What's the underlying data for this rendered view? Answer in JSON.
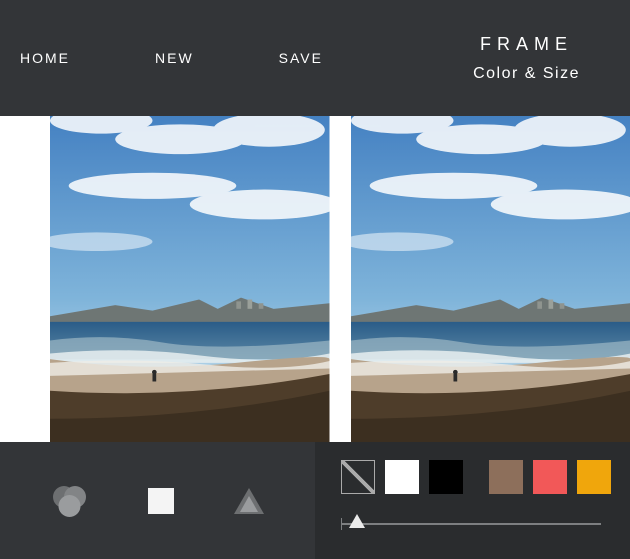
{
  "nav": {
    "home": "HOME",
    "new": "NEW",
    "save": "SAVE"
  },
  "header": {
    "title": "FRAME",
    "subtitle": "Color & Size"
  },
  "swatches": {
    "none": "transparent",
    "white": "#ffffff",
    "black": "#000000",
    "tan": "#8d6f5b",
    "red": "#f25858",
    "gold": "#f0a60c"
  },
  "slider": {
    "value": 0
  }
}
